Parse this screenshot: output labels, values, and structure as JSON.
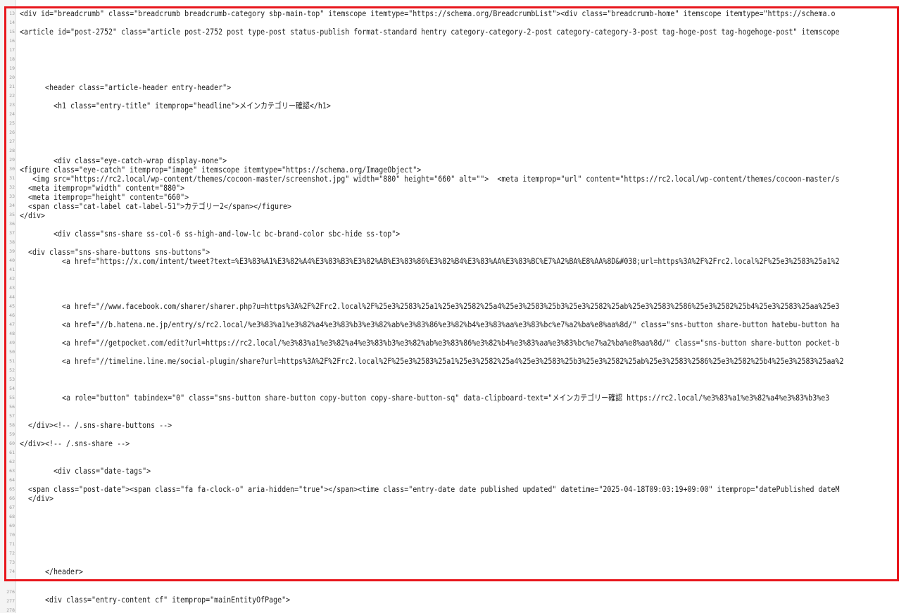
{
  "line_numbers": [
    "13",
    "14",
    "15",
    "16",
    "17",
    "18",
    "19",
    "20",
    "21",
    "22",
    "23",
    "24",
    "25",
    "26",
    "27",
    "28",
    "29",
    "30",
    "31",
    "32",
    "33",
    "34",
    "35",
    "36",
    "37",
    "38",
    "39",
    "40",
    "41",
    "42",
    "43",
    "44",
    "45",
    "46",
    "47",
    "48",
    "49",
    "50",
    "51",
    "52",
    "53",
    "54",
    "55",
    "56",
    "57",
    "58",
    "59",
    "60",
    "61",
    "62",
    "63",
    "64",
    "65",
    "66",
    "67",
    "68",
    "69",
    "70",
    "71",
    "72",
    "73",
    "74",
    "276",
    "277",
    "278"
  ],
  "code_lines": [
    {
      "text": "<div id=\"breadcrumb\" class=\"breadcrumb breadcrumb-category sbp-main-top\" itemscope itemtype=\"https://schema.org/BreadcrumbList\"><div class=\"breadcrumb-home\" itemscope itemtype=\"https://schema.o"
    },
    {
      "text": "<article id=\"post-2752\" class=\"article post-2752 post type-post status-publish format-standard hentry category-category-2-post category-category-3-post tag-hoge-post tag-hogehoge-post\" itemscope"
    },
    {
      "text": "      <header class=\"article-header entry-header\">"
    },
    {
      "text": "        <h1 class=\"entry-title\" itemprop=\"headline\">メインカテゴリー確認</h1>"
    },
    {
      "text": "        <div class=\"eye-catch-wrap display-none\">"
    },
    {
      "text": "<figure class=\"eye-catch\" itemprop=\"image\" itemscope itemtype=\"https://schema.org/ImageObject\">"
    },
    {
      "text": "   <img src=\"https://rc2.local/wp-content/themes/cocoon-master/screenshot.jpg\" width=\"880\" height=\"660\" alt=\"\">  <meta itemprop=\"url\" content=\"https://rc2.local/wp-content/themes/cocoon-master/s"
    },
    {
      "text": "  <meta itemprop=\"width\" content=\"880\">"
    },
    {
      "text": "  <meta itemprop=\"height\" content=\"660\">"
    },
    {
      "text": "  <span class=\"cat-label cat-label-51\">カテゴリー2</span></figure>"
    },
    {
      "text": "</div>"
    },
    {
      "text": "        <div class=\"sns-share ss-col-6 ss-high-and-low-lc bc-brand-color sbc-hide ss-top\">"
    },
    {
      "text": "  <div class=\"sns-share-buttons sns-buttons\">"
    },
    {
      "text": "          <a href=\"https://x.com/intent/tweet?text=%E3%83%A1%E3%82%A4%E3%83%B3%E3%82%AB%E3%83%86%E3%82%B4%E3%83%AA%E3%83%BC%E7%A2%BA%E8%AA%8D&#038;url=https%3A%2F%2Frc2.local%2F%25e3%2583%25a1%2"
    },
    {
      "text": "          <a href=\"//www.facebook.com/sharer/sharer.php?u=https%3A%2F%2Frc2.local%2F%25e3%2583%25a1%25e3%2582%25a4%25e3%2583%25b3%25e3%2582%25ab%25e3%2583%2586%25e3%2582%25b4%25e3%2583%25aa%25e3"
    },
    {
      "text": "          <a href=\"//b.hatena.ne.jp/entry/s/rc2.local/%e3%83%a1%e3%82%a4%e3%83%b3%e3%82%ab%e3%83%86%e3%82%b4%e3%83%aa%e3%83%bc%e7%a2%ba%e8%aa%8d/\" class=\"sns-button share-button hatebu-button ha"
    },
    {
      "text": "          <a href=\"//getpocket.com/edit?url=https://rc2.local/%e3%83%a1%e3%82%a4%e3%83%b3%e3%82%ab%e3%83%86%e3%82%b4%e3%83%aa%e3%83%bc%e7%a2%ba%e8%aa%8d/\" class=\"sns-button share-button pocket-b"
    },
    {
      "text": "          <a href=\"//timeline.line.me/social-plugin/share?url=https%3A%2F%2Frc2.local%2F%25e3%2583%25a1%25e3%2582%25a4%25e3%2583%25b3%25e3%2582%25ab%25e3%2583%2586%25e3%2582%25b4%25e3%2583%25aa%2"
    },
    {
      "text": "          <a role=\"button\" tabindex=\"0\" class=\"sns-button share-button copy-button copy-share-button-sq\" data-clipboard-text=\"メインカテゴリー確認 https://rc2.local/%e3%83%a1%e3%82%a4%e3%83%b3%e3"
    },
    {
      "text": "  </div><!-- /.sns-share-buttons -->"
    },
    {
      "text": "</div><!-- /.sns-share -->"
    },
    {
      "text": "        <div class=\"date-tags\">"
    },
    {
      "text": "  <span class=\"post-date\"><span class=\"fa fa-clock-o\" aria-hidden=\"true\"></span><time class=\"entry-date date published updated\" datetime=\"2025-04-18T09:03:19+09:00\" itemprop=\"datePublished dateM"
    },
    {
      "text": "  </div>"
    },
    {
      "text": "      </header>"
    },
    {
      "text": "      <div class=\"entry-content cf\" itemprop=\"mainEntityOfPage\">"
    }
  ],
  "colors": {
    "highlight_border": "#e8161c",
    "tag": "#7a3a7a",
    "link": "#1a1aa6",
    "gutter": "#f4f4f4"
  }
}
